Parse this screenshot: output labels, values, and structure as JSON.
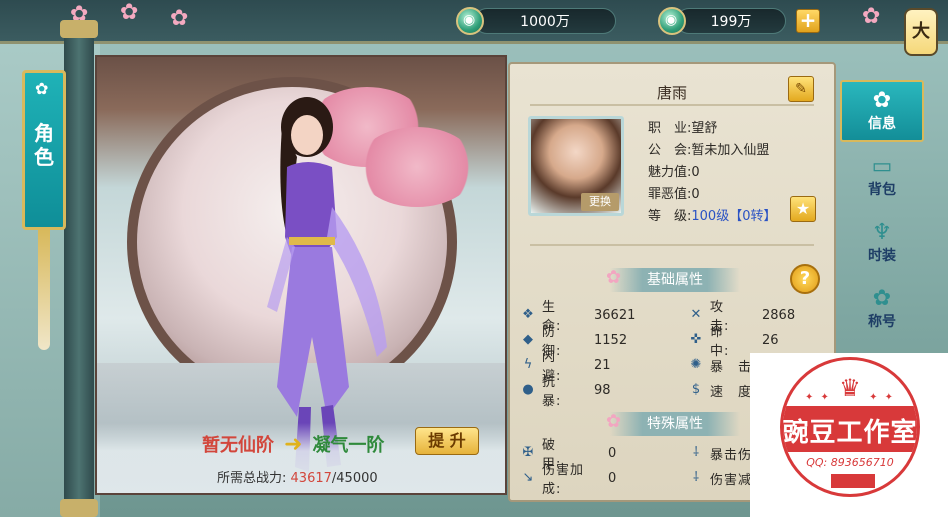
{
  "currency": {
    "silver": "1000万",
    "gold": "199万",
    "add_label": "+"
  },
  "close_label": "大",
  "side_tab": {
    "label_line1": "角",
    "label_line2": "色"
  },
  "character": {
    "name": "唐雨",
    "swap_label": "更换",
    "info": [
      {
        "label": "职　业:",
        "value": "望舒"
      },
      {
        "label": "公　会:",
        "value": "暂未加入仙盟"
      },
      {
        "label": "魅力值:",
        "value": "0"
      },
      {
        "label": "罪恶值:",
        "value": "0"
      },
      {
        "label": "等　级:",
        "value": "100级【0转】"
      }
    ]
  },
  "sections": {
    "base": "基础属性",
    "special": "特殊属性"
  },
  "base_attrs": [
    {
      "icon": "hp-drop-icon",
      "glyph": "❖",
      "label": "生　命:",
      "value": "36621"
    },
    {
      "icon": "crossed-swords-icon",
      "glyph": "✕",
      "label": "攻　击:",
      "value": "2868"
    },
    {
      "icon": "shield-icon",
      "glyph": "◆",
      "label": "防　御:",
      "value": "1152"
    },
    {
      "icon": "crosshair-icon",
      "glyph": "✜",
      "label": "命　中:",
      "value": "26"
    },
    {
      "icon": "dodge-icon",
      "glyph": "ϟ",
      "label": "闪　避:",
      "value": "21"
    },
    {
      "icon": "crit-target-icon",
      "glyph": "✺",
      "label": "暴　击",
      "value": ""
    },
    {
      "icon": "anti-crit-icon",
      "glyph": "●",
      "label": "抗　暴:",
      "value": "98"
    },
    {
      "icon": "speed-icon",
      "glyph": "$",
      "label": "速　度",
      "value": ""
    }
  ],
  "special_attrs": [
    {
      "icon": "pierce-icon",
      "glyph": "✠",
      "label": "破　　甲:",
      "value": "0"
    },
    {
      "icon": "crit-dmg-icon",
      "glyph": "⸸",
      "label": "暴击伤",
      "value": ""
    },
    {
      "icon": "dmg-bonus-icon",
      "glyph": "↘",
      "label": "伤害加成:",
      "value": "0"
    },
    {
      "icon": "dmg-reduce-icon",
      "glyph": "⸸",
      "label": "伤害减",
      "value": ""
    }
  ],
  "tabs": [
    {
      "icon": "lotus-icon",
      "glyph": "✿",
      "label": "信息",
      "active": true
    },
    {
      "icon": "bag-icon",
      "glyph": "▭",
      "label": "背包",
      "active": false
    },
    {
      "icon": "robe-icon",
      "glyph": "♆",
      "label": "时装",
      "active": false
    },
    {
      "icon": "title-lotus-icon",
      "glyph": "✿",
      "label": "称号",
      "active": false
    }
  ],
  "upgrade": {
    "current": "暂无仙阶",
    "arrow": "➜",
    "next": "凝气一阶",
    "button": "提 升",
    "req_label": "所需总战力:",
    "req_current": "43617",
    "req_total": "/45000"
  },
  "watermark": {
    "text": "豌豆工作室",
    "qq": "QQ: 893656710"
  },
  "colors": {
    "accent_teal": "#138e98",
    "gold": "#e3a91f",
    "red": "#d2463b",
    "green": "#2f8a3b",
    "level_blue": "#2a52c4"
  }
}
